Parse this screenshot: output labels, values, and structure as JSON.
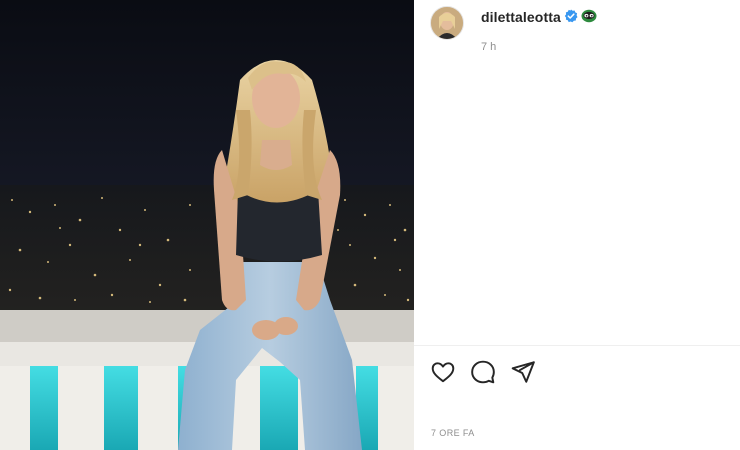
{
  "post": {
    "username": "dilettaleotta",
    "time_short": "7 h",
    "time_long": "7 ORE FA"
  },
  "icons": {
    "verified": "verified-badge-icon",
    "emoji": "glasses-emoji-icon",
    "like": "heart-icon",
    "comment": "comment-bubble-icon",
    "share": "send-icon"
  },
  "colors": {
    "verified_blue": "#3897f0",
    "text_primary": "#262626",
    "text_secondary": "#8e8e8e",
    "pool_cyan": "#27c6cf"
  }
}
